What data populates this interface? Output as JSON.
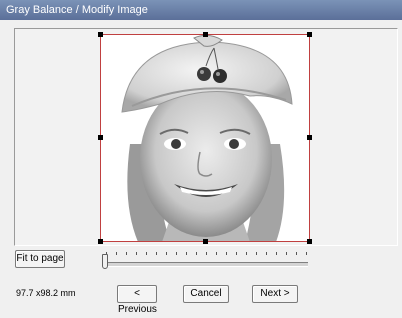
{
  "window": {
    "title": "Gray Balance / Modify Image"
  },
  "image": {
    "subject": "girl in knit beret with cherry pin"
  },
  "toolbar": {
    "fit_label": "Fit to page"
  },
  "zoom_slider": {
    "value": 0
  },
  "status": {
    "size": "97.7 x98.2 mm"
  },
  "nav": {
    "previous_label": "< Previous",
    "cancel_label": "Cancel",
    "next_label": "Next >"
  },
  "colors": {
    "titlebar": "#6a80a8",
    "crop_border": "#c04040",
    "dialog_bg": "#f0f0f0"
  }
}
